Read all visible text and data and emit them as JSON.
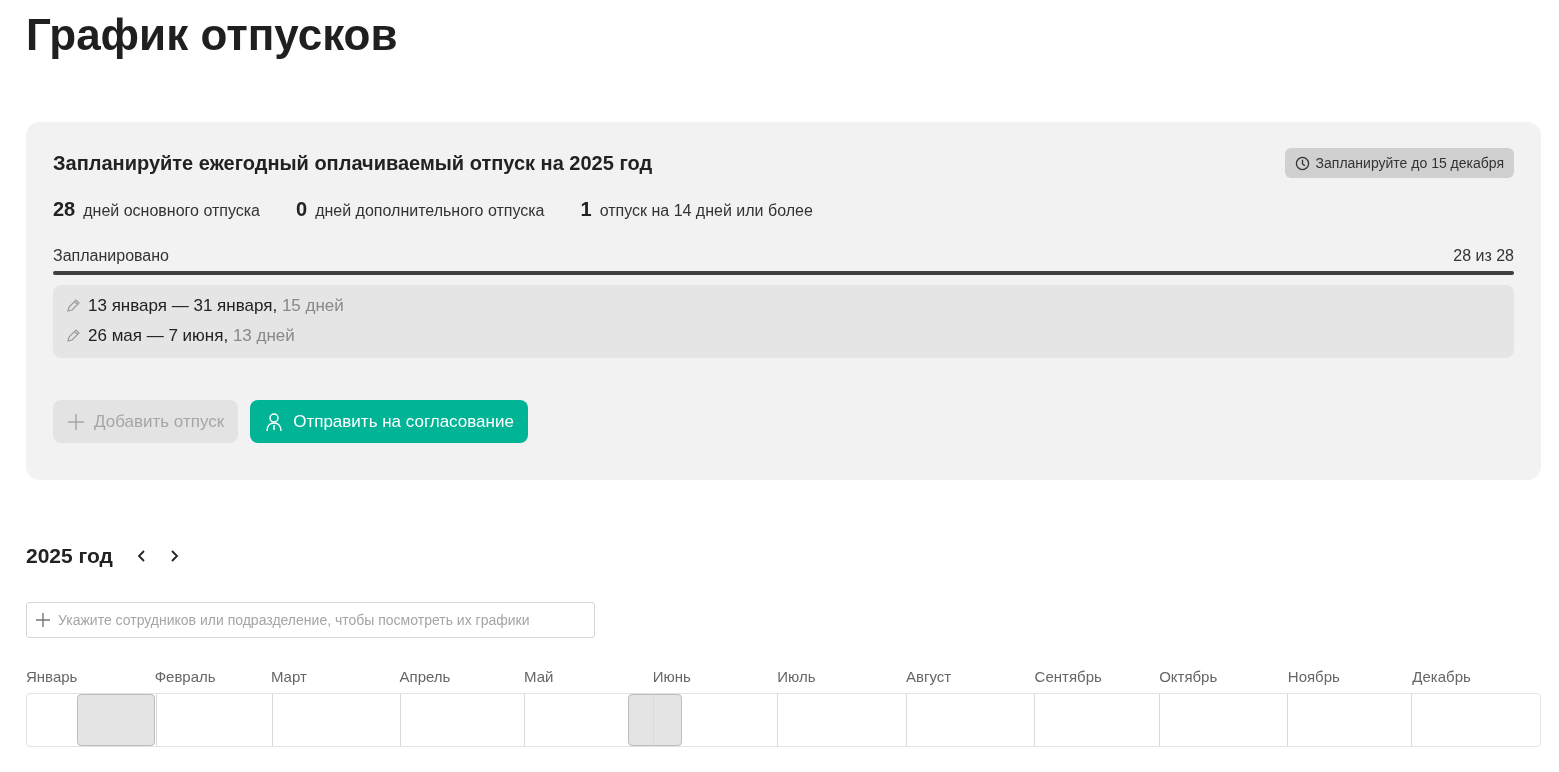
{
  "page_title": "График отпусков",
  "plan_card": {
    "title": "Запланируйте ежегодный оплачиваемый отпуск на 2025 год",
    "deadline_badge": "Запланируйте до 15 декабря",
    "stats": [
      {
        "value": "28",
        "label": "дней основного отпуска"
      },
      {
        "value": "0",
        "label": "дней дополнительного отпуска"
      },
      {
        "value": "1",
        "label": "отпуск на 14 дней или более"
      }
    ],
    "progress": {
      "label": "Запланировано",
      "reading": "28 из 28",
      "level": 1
    },
    "vacations": [
      {
        "dates": "13 января — 31 января,",
        "duration": "15 дней"
      },
      {
        "dates": "26 мая — 7 июня,",
        "duration": "13 дней"
      }
    ],
    "buttons": [
      {
        "label": "Добавить отпуск",
        "kind": "add",
        "disabled": true
      },
      {
        "label": "Отправить на согласование",
        "kind": "submit",
        "disabled": false
      }
    ]
  },
  "timeline": {
    "year": "2025 год",
    "employee_field": {
      "placeholder": "Укажите сотрудников или подразделение, чтобы посмотреть их графики"
    },
    "months": [
      "Январь",
      "Февраль",
      "Март",
      "Апрель",
      "Май",
      "Июнь",
      "Июль",
      "Август",
      "Сентябрь",
      "Октябрь",
      "Ноябрь",
      "Декабрь"
    ]
  }
}
